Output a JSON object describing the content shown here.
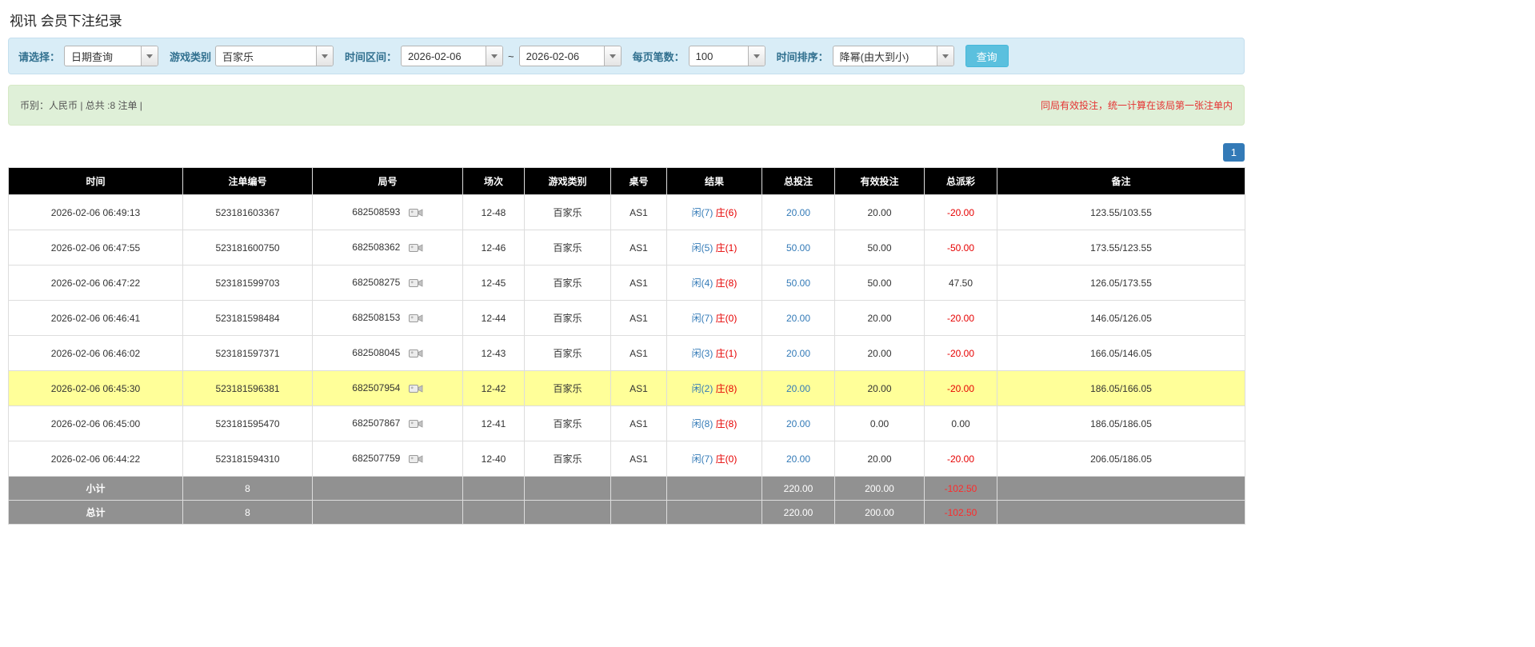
{
  "colors": {
    "accent_blue": "#337ab7",
    "query_button_blue": "#5bc0de",
    "filter_bar_bg": "#d9edf7",
    "summary_bar_bg": "#dff0d8",
    "highlight_yellow": "#ffff99",
    "negative_red": "#e60000",
    "table_header_bg": "#000000",
    "footer_gray": "#919191"
  },
  "page": {
    "title": "视讯 会员下注纪录"
  },
  "filters": {
    "select": {
      "label": "请选择：",
      "value": "日期查询"
    },
    "game_type": {
      "label": "游戏类别",
      "value": "百家乐"
    },
    "time_range": {
      "label": "时间区间：",
      "from": "2026-02-06",
      "separator": "~",
      "to": "2026-02-06"
    },
    "page_size": {
      "label": "每页笔数：",
      "value": "100"
    },
    "sort": {
      "label": "时间排序：",
      "value": "降幂(由大到小)"
    },
    "query_button": "查询"
  },
  "summary": {
    "left": "币别：人民币 | 总共 :8 注单 |",
    "right": "同局有效投注，统一计算在该局第一张注单内"
  },
  "pagination": {
    "current": "1"
  },
  "table": {
    "headers": [
      "时间",
      "注单编号",
      "局号",
      "场次",
      "游戏类别",
      "桌号",
      "结果",
      "总投注",
      "有效投注",
      "总派彩",
      "备注"
    ],
    "rows": [
      {
        "time": "2026-02-06 06:49:13",
        "order_no": "523181603367",
        "round_no": "682508593",
        "session": "12-48",
        "game": "百家乐",
        "table_no": "AS1",
        "result_player": "闲(7)",
        "result_banker": "庄(6)",
        "total_bet": "20.00",
        "valid_bet": "20.00",
        "payout": "-20.00",
        "remark": "123.55/103.55",
        "highlight": false
      },
      {
        "time": "2026-02-06 06:47:55",
        "order_no": "523181600750",
        "round_no": "682508362",
        "session": "12-46",
        "game": "百家乐",
        "table_no": "AS1",
        "result_player": "闲(5)",
        "result_banker": "庄(1)",
        "total_bet": "50.00",
        "valid_bet": "50.00",
        "payout": "-50.00",
        "remark": "173.55/123.55",
        "highlight": false
      },
      {
        "time": "2026-02-06 06:47:22",
        "order_no": "523181599703",
        "round_no": "682508275",
        "session": "12-45",
        "game": "百家乐",
        "table_no": "AS1",
        "result_player": "闲(4)",
        "result_banker": "庄(8)",
        "total_bet": "50.00",
        "valid_bet": "50.00",
        "payout": "47.50",
        "remark": "126.05/173.55",
        "highlight": false
      },
      {
        "time": "2026-02-06 06:46:41",
        "order_no": "523181598484",
        "round_no": "682508153",
        "session": "12-44",
        "game": "百家乐",
        "table_no": "AS1",
        "result_player": "闲(7)",
        "result_banker": "庄(0)",
        "total_bet": "20.00",
        "valid_bet": "20.00",
        "payout": "-20.00",
        "remark": "146.05/126.05",
        "highlight": false
      },
      {
        "time": "2026-02-06 06:46:02",
        "order_no": "523181597371",
        "round_no": "682508045",
        "session": "12-43",
        "game": "百家乐",
        "table_no": "AS1",
        "result_player": "闲(3)",
        "result_banker": "庄(1)",
        "total_bet": "20.00",
        "valid_bet": "20.00",
        "payout": "-20.00",
        "remark": "166.05/146.05",
        "highlight": false
      },
      {
        "time": "2026-02-06 06:45:30",
        "order_no": "523181596381",
        "round_no": "682507954",
        "session": "12-42",
        "game": "百家乐",
        "table_no": "AS1",
        "result_player": "闲(2)",
        "result_banker": "庄(8)",
        "total_bet": "20.00",
        "valid_bet": "20.00",
        "payout": "-20.00",
        "remark": "186.05/166.05",
        "highlight": true
      },
      {
        "time": "2026-02-06 06:45:00",
        "order_no": "523181595470",
        "round_no": "682507867",
        "session": "12-41",
        "game": "百家乐",
        "table_no": "AS1",
        "result_player": "闲(8)",
        "result_banker": "庄(8)",
        "total_bet": "20.00",
        "valid_bet": "0.00",
        "payout": "0.00",
        "remark": "186.05/186.05",
        "highlight": false
      },
      {
        "time": "2026-02-06 06:44:22",
        "order_no": "523181594310",
        "round_no": "682507759",
        "session": "12-40",
        "game": "百家乐",
        "table_no": "AS1",
        "result_player": "闲(7)",
        "result_banker": "庄(0)",
        "total_bet": "20.00",
        "valid_bet": "20.00",
        "payout": "-20.00",
        "remark": "206.05/186.05",
        "highlight": false
      }
    ],
    "subtotal": {
      "label": "小计",
      "count": "8",
      "total_bet": "220.00",
      "valid_bet": "200.00",
      "payout": "-102.50"
    },
    "total": {
      "label": "总计",
      "count": "8",
      "total_bet": "220.00",
      "valid_bet": "200.00",
      "payout": "-102.50"
    }
  }
}
